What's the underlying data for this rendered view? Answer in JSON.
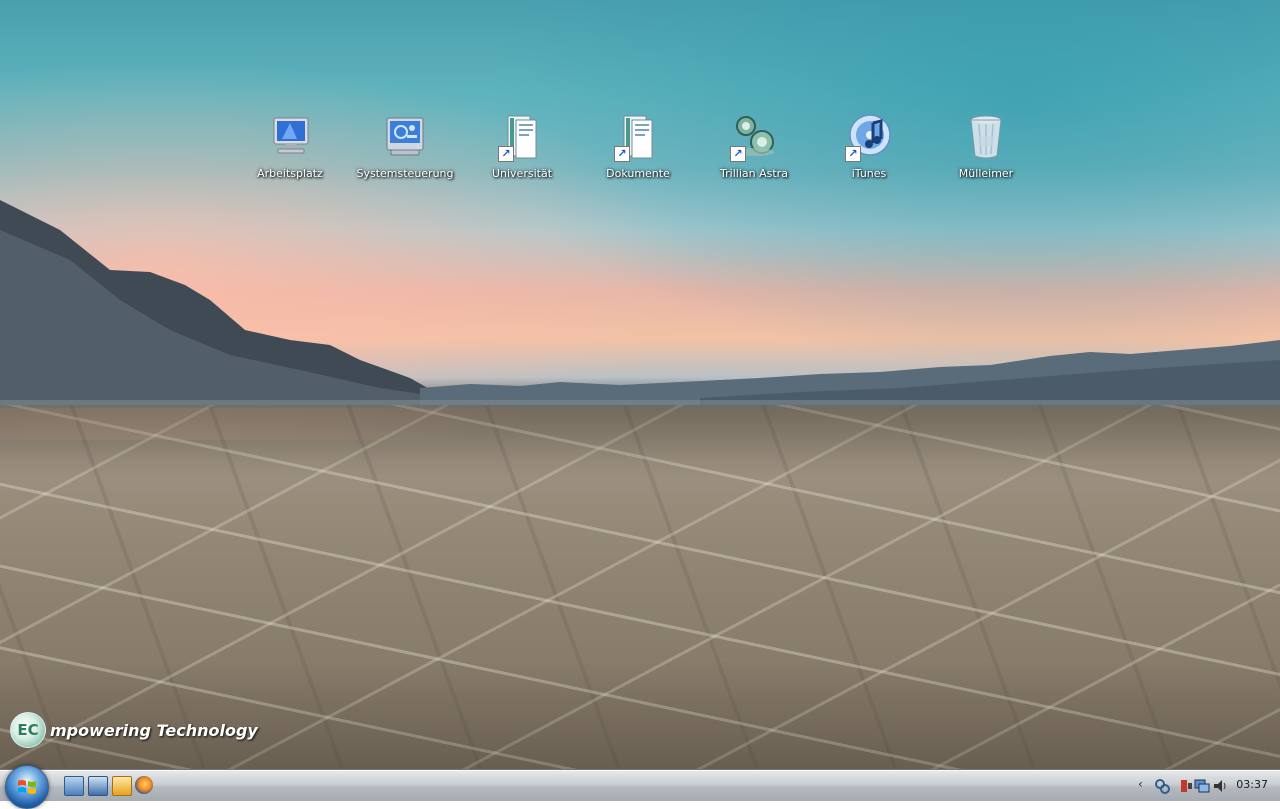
{
  "desktop": {
    "icons": [
      {
        "label": "Arbeitsplatz"
      },
      {
        "label": "Systemsteuerung"
      },
      {
        "label": "Universität"
      },
      {
        "label": "Dokumente"
      },
      {
        "label": "Trillian Astra"
      },
      {
        "label": "iTunes"
      },
      {
        "label": "Mülleimer"
      }
    ]
  },
  "branding": {
    "logo_letters": "EC",
    "text": "mpowering Technology"
  },
  "taskbar": {
    "clock": "03:37",
    "tray_chevron": "‹"
  },
  "colors": {
    "taskbar": "#c9cdd2",
    "start_orb": "#1f5fa8",
    "icon_label": "#ffffff"
  }
}
